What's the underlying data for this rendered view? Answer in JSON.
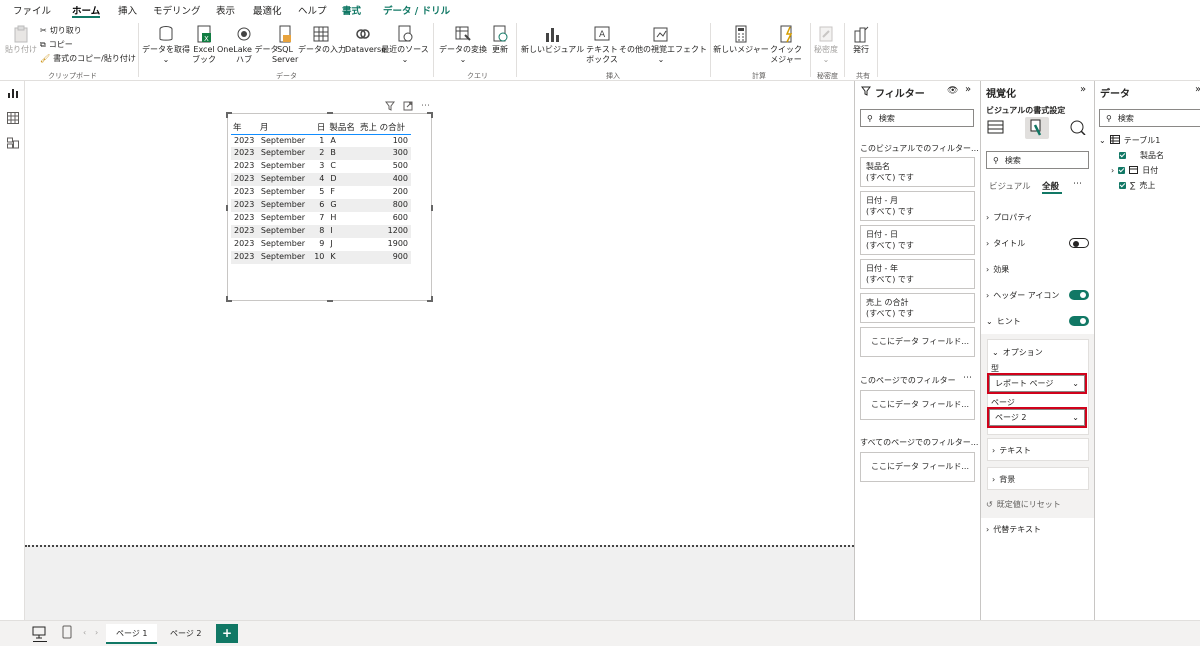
{
  "menu": {
    "tabs": [
      "ファイル",
      "ホーム",
      "挿入",
      "モデリング",
      "表示",
      "最適化",
      "ヘルプ",
      "書式",
      "データ / ドリル"
    ],
    "active": "ホーム"
  },
  "ribbon": {
    "paste": "貼り付け",
    "cut": "切り取り",
    "copy": "コピー",
    "format_painter": "書式のコピー/貼り付け",
    "group_clipboard": "クリップボード",
    "get_data_1": "データを取得",
    "excel_1": "Excel",
    "excel_2": "ブック",
    "onelake_1": "OneLake データ",
    "onelake_2": "ハブ",
    "sql_1": "SQL",
    "sql_2": "Server",
    "enter_data": "データの入力",
    "dataverse": "Dataverse",
    "recent_sources": "最近のソース",
    "group_data": "データ",
    "transform_data": "データの変換",
    "refresh": "更新",
    "group_query": "クエリ",
    "new_visual": "新しいビジュアル",
    "textbox_1": "テキスト",
    "textbox_2": "ボックス",
    "more_visuals": "その他の視覚エフェクト",
    "group_insert": "挿入",
    "new_measure": "新しいメジャー",
    "quick_measure_1": "クイック",
    "quick_measure_2": "メジャー",
    "group_calc": "計算",
    "sensitivity": "秘密度",
    "group_sensitivity": "秘密度",
    "publish": "発行",
    "group_share": "共有"
  },
  "table_visual": {
    "headers": [
      "年",
      "月",
      "日",
      "製品名",
      "売上 の合計"
    ],
    "rows": [
      [
        "2023",
        "September",
        "1",
        "A",
        "100"
      ],
      [
        "2023",
        "September",
        "2",
        "B",
        "300"
      ],
      [
        "2023",
        "September",
        "3",
        "C",
        "500"
      ],
      [
        "2023",
        "September",
        "4",
        "D",
        "400"
      ],
      [
        "2023",
        "September",
        "5",
        "F",
        "200"
      ],
      [
        "2023",
        "September",
        "6",
        "G",
        "800"
      ],
      [
        "2023",
        "September",
        "7",
        "H",
        "600"
      ],
      [
        "2023",
        "September",
        "8",
        "I",
        "1200"
      ],
      [
        "2023",
        "September",
        "9",
        "J",
        "1900"
      ],
      [
        "2023",
        "September",
        "10",
        "K",
        "900"
      ]
    ]
  },
  "pages": {
    "tab1": "ページ 1",
    "tab2": "ページ 2",
    "add": "+"
  },
  "filters": {
    "title": "フィルター",
    "search_placeholder": "検索",
    "visual_section": "このビジュアルでのフィルター...",
    "cards": [
      {
        "name": "製品名",
        "value": "(すべて) です"
      },
      {
        "name": "日付 - 月",
        "value": "(すべて) です"
      },
      {
        "name": "日付 - 日",
        "value": "(すべて) です"
      },
      {
        "name": "日付 - 年",
        "value": "(すべて) です"
      },
      {
        "name": "売上 の合計",
        "value": "(すべて) です"
      }
    ],
    "add_field": "ここにデータ フィールド...",
    "page_section": "このページでのフィルター",
    "all_pages_section": "すべてのページでのフィルター..."
  },
  "viz": {
    "title": "視覚化",
    "subtitle": "ビジュアルの書式設定",
    "search_placeholder": "検索",
    "tab_visual": "ビジュアル",
    "tab_general": "全般",
    "properties": "プロパティ",
    "title_row": "タイトル",
    "effects": "効果",
    "header_icons": "ヘッダー アイコン",
    "tooltips": "ヒント",
    "options": "オプション",
    "type_label": "型",
    "type_value": "レポート ページ",
    "page_label": "ページ",
    "page_value": "ページ 2",
    "text": "テキスト",
    "background": "背景",
    "reset": "既定値にリセット",
    "alt_text": "代替テキスト"
  },
  "data_pane": {
    "title": "データ",
    "search_placeholder": "検索",
    "table": "テーブル1",
    "fields": [
      "製品名",
      "日付",
      "売上"
    ]
  },
  "colors": {
    "accent": "#117865",
    "highlight": "#d0021b",
    "header_line": "#118dff"
  }
}
